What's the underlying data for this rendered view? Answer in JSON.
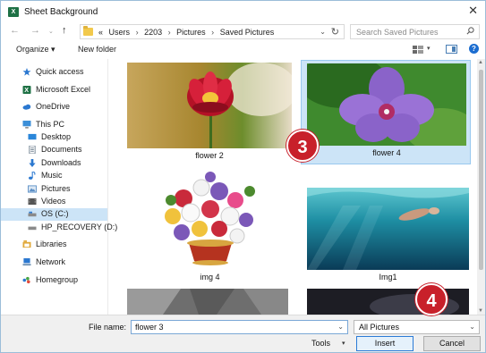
{
  "window": {
    "title": "Sheet Background",
    "app_icon_letter": "X",
    "close_glyph": "✕"
  },
  "nav": {
    "back_glyph": "←",
    "forward_glyph": "→",
    "up_glyph": "↑",
    "address_prefix": "«",
    "breadcrumbs": [
      "Users",
      "2203",
      "Pictures",
      "Saved Pictures"
    ],
    "separator": "›",
    "dropdown_glyph": "⌄",
    "refresh_glyph": "↻",
    "search_placeholder": "Search Saved Pictures"
  },
  "toolbar": {
    "organize_label": "Organize ▾",
    "new_folder_label": "New folder",
    "view_dropdown_glyph": "▾",
    "help_glyph": "?"
  },
  "sidebar": {
    "items": [
      {
        "label": "Quick access",
        "icon": "star-icon",
        "color": "#2b78d0"
      },
      {
        "label": "Microsoft Excel",
        "icon": "excel-icon",
        "color": "#1e7145"
      },
      {
        "label": "OneDrive",
        "icon": "cloud-icon",
        "color": "#2b78d0"
      },
      {
        "label": "This PC",
        "icon": "computer-icon",
        "color": "#3c8fd8"
      },
      {
        "label": "Desktop",
        "icon": "desktop-icon",
        "color": "#2a86d9"
      },
      {
        "label": "Documents",
        "icon": "documents-icon",
        "color": "#6d7e8e"
      },
      {
        "label": "Downloads",
        "icon": "download-icon",
        "color": "#2b78d0"
      },
      {
        "label": "Music",
        "icon": "music-icon",
        "color": "#2b78d0"
      },
      {
        "label": "Pictures",
        "icon": "pictures-icon",
        "color": "#5b8fc6"
      },
      {
        "label": "Videos",
        "icon": "videos-icon",
        "color": "#555"
      },
      {
        "label": "OS (C:)",
        "icon": "drive-icon",
        "color": "#6b6b6b"
      },
      {
        "label": "HP_RECOVERY (D:)",
        "icon": "drive-icon",
        "color": "#6b6b6b"
      },
      {
        "label": "Libraries",
        "icon": "libraries-icon",
        "color": "#e0a93a"
      },
      {
        "label": "Network",
        "icon": "network-icon",
        "color": "#2b78d0"
      },
      {
        "label": "Homegroup",
        "icon": "homegroup-icon",
        "color": "#2b78d0"
      }
    ],
    "selected_index": 10
  },
  "files": [
    {
      "name": "flower 2",
      "selected": false
    },
    {
      "name": "flower 4",
      "selected": true
    },
    {
      "name": "img 4",
      "selected": false
    },
    {
      "name": "Img1",
      "selected": false
    },
    {
      "name": "",
      "selected": false
    },
    {
      "name": "",
      "selected": false
    }
  ],
  "footer": {
    "filename_label": "File name:",
    "filename_value": "flower 3",
    "filetype_value": "All Pictures",
    "tools_label": "Tools",
    "insert_label": "Insert",
    "cancel_label": "Cancel",
    "dropdown_glyph": "⌄"
  },
  "callouts": {
    "step3": "3",
    "step4": "4"
  },
  "colors": {
    "accent": "#2c7bd6",
    "callout": "#c8202a",
    "selection": "#cce4f7"
  }
}
